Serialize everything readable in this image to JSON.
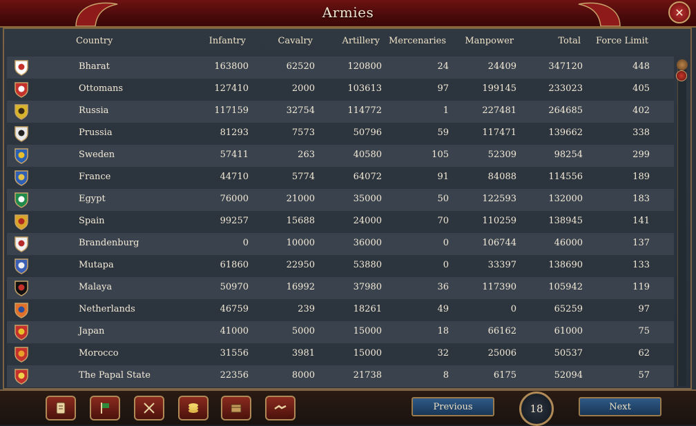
{
  "window": {
    "title": "Armies",
    "close_symbol": "✕"
  },
  "headers": {
    "country": "Country",
    "infantry": "Infantry",
    "cavalry": "Cavalry",
    "artillery": "Artillery",
    "mercenaries": "Mercenaries",
    "manpower": "Manpower",
    "total": "Total",
    "force_limit": "Force Limit"
  },
  "rows": [
    {
      "country": "Bharat",
      "infantry": "163800",
      "cavalry": "62520",
      "artillery": "120800",
      "mercenaries": "24",
      "manpower": "24409",
      "total": "347120",
      "force_limit": "448",
      "flag_colors": [
        "#ffffff",
        "#c4302b"
      ]
    },
    {
      "country": "Ottomans",
      "infantry": "127410",
      "cavalry": "2000",
      "artillery": "103613",
      "mercenaries": "97",
      "manpower": "199145",
      "total": "233023",
      "force_limit": "405",
      "flag_colors": [
        "#c4302b",
        "#ffffff"
      ]
    },
    {
      "country": "Russia",
      "infantry": "117159",
      "cavalry": "32754",
      "artillery": "114772",
      "mercenaries": "1",
      "manpower": "227481",
      "total": "264685",
      "force_limit": "402",
      "flag_colors": [
        "#d8b42a",
        "#3a2a1a"
      ]
    },
    {
      "country": "Prussia",
      "infantry": "81293",
      "cavalry": "7573",
      "artillery": "50796",
      "mercenaries": "59",
      "manpower": "117471",
      "total": "139662",
      "force_limit": "338",
      "flag_colors": [
        "#e8e8e8",
        "#222222"
      ]
    },
    {
      "country": "Sweden",
      "infantry": "57411",
      "cavalry": "263",
      "artillery": "40580",
      "mercenaries": "105",
      "manpower": "52309",
      "total": "98254",
      "force_limit": "299",
      "flag_colors": [
        "#2b5fb0",
        "#e5c02a"
      ]
    },
    {
      "country": "France",
      "infantry": "44710",
      "cavalry": "5774",
      "artillery": "64072",
      "mercenaries": "91",
      "manpower": "84088",
      "total": "114556",
      "force_limit": "189",
      "flag_colors": [
        "#2f5fb4",
        "#e3c24a"
      ]
    },
    {
      "country": "Egypt",
      "infantry": "76000",
      "cavalry": "21000",
      "artillery": "35000",
      "mercenaries": "50",
      "manpower": "122593",
      "total": "132000",
      "force_limit": "183",
      "flag_colors": [
        "#1f8a4a",
        "#ffffff"
      ]
    },
    {
      "country": "Spain",
      "infantry": "99257",
      "cavalry": "15688",
      "artillery": "24000",
      "mercenaries": "70",
      "manpower": "110259",
      "total": "138945",
      "force_limit": "141",
      "flag_colors": [
        "#d8a52a",
        "#b02a22"
      ]
    },
    {
      "country": "Brandenburg",
      "infantry": "0",
      "cavalry": "10000",
      "artillery": "36000",
      "mercenaries": "0",
      "manpower": "106744",
      "total": "46000",
      "force_limit": "137",
      "flag_colors": [
        "#f0f0f0",
        "#b42a2a"
      ]
    },
    {
      "country": "Mutapa",
      "infantry": "61860",
      "cavalry": "22950",
      "artillery": "53880",
      "mercenaries": "0",
      "manpower": "33397",
      "total": "138690",
      "force_limit": "133",
      "flag_colors": [
        "#3a5fb4",
        "#f0f0f0"
      ]
    },
    {
      "country": "Malaya",
      "infantry": "50970",
      "cavalry": "16992",
      "artillery": "37980",
      "mercenaries": "36",
      "manpower": "117390",
      "total": "105942",
      "force_limit": "119",
      "flag_colors": [
        "#111111",
        "#c4302b"
      ]
    },
    {
      "country": "Netherlands",
      "infantry": "46759",
      "cavalry": "239",
      "artillery": "18261",
      "mercenaries": "49",
      "manpower": "0",
      "total": "65259",
      "force_limit": "97",
      "flag_colors": [
        "#e0702a",
        "#2a4f9a"
      ]
    },
    {
      "country": "Japan",
      "infantry": "41000",
      "cavalry": "5000",
      "artillery": "15000",
      "mercenaries": "18",
      "manpower": "66162",
      "total": "61000",
      "force_limit": "75",
      "flag_colors": [
        "#c4302b",
        "#e8c02a"
      ]
    },
    {
      "country": "Morocco",
      "infantry": "31556",
      "cavalry": "3981",
      "artillery": "15000",
      "mercenaries": "32",
      "manpower": "25006",
      "total": "50537",
      "force_limit": "62",
      "flag_colors": [
        "#c4302b",
        "#e8a02a"
      ]
    },
    {
      "country": "The Papal State",
      "infantry": "22356",
      "cavalry": "8000",
      "artillery": "21738",
      "mercenaries": "8",
      "manpower": "6175",
      "total": "52094",
      "force_limit": "57",
      "flag_colors": [
        "#c4302b",
        "#f0d24a"
      ]
    }
  ],
  "pagination": {
    "previous": "Previous",
    "next": "Next",
    "page": "18"
  },
  "toolbar_icons": [
    "scroll-icon",
    "flag-icon",
    "crossed-swords-icon",
    "coins-icon",
    "crate-icon",
    "handshake-icon"
  ]
}
